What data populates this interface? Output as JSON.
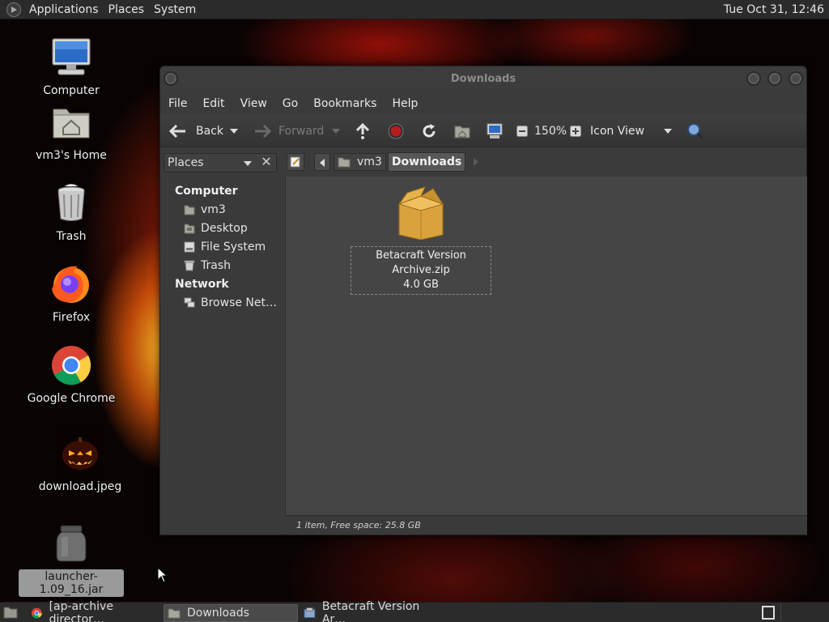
{
  "top_panel": {
    "menus": [
      "Applications",
      "Places",
      "System"
    ],
    "clock": "Tue Oct 31, 12:46"
  },
  "desktop": {
    "icons": [
      {
        "label": "Computer",
        "icon": "computer-icon"
      },
      {
        "label": "vm3's Home",
        "icon": "home-folder-icon"
      },
      {
        "label": "Trash",
        "icon": "trash-icon"
      },
      {
        "label": "Firefox",
        "icon": "firefox-icon"
      },
      {
        "label": "Google Chrome",
        "icon": "chrome-icon"
      },
      {
        "label": "download.jpeg",
        "icon": "image-thumbnail-icon"
      },
      {
        "label": "launcher-1.09_16.jar",
        "icon": "jar-icon"
      }
    ]
  },
  "window": {
    "title": "Downloads",
    "menu": [
      "File",
      "Edit",
      "View",
      "Go",
      "Bookmarks",
      "Help"
    ],
    "toolbar": {
      "back": "Back",
      "forward": "Forward",
      "zoom": "150%",
      "view_mode": "Icon View"
    },
    "places_selector": "Places",
    "path": [
      "vm3",
      "Downloads"
    ],
    "sidebar": {
      "sections": [
        {
          "header": "Computer",
          "items": [
            {
              "label": "vm3",
              "icon": "home-icon"
            },
            {
              "label": "Desktop",
              "icon": "desktop-icon"
            },
            {
              "label": "File System",
              "icon": "drive-icon"
            },
            {
              "label": "Trash",
              "icon": "trash-icon"
            }
          ]
        },
        {
          "header": "Network",
          "items": [
            {
              "label": "Browse Net…",
              "icon": "network-icon"
            }
          ]
        }
      ]
    },
    "files": [
      {
        "name": "Betacraft Version Archive.zip",
        "size": "4.0 GB",
        "icon": "package-icon"
      }
    ],
    "status": "1 item, Free space: 25.8 GB"
  },
  "taskbar": {
    "tasks": [
      {
        "label": "[ap-archive director…",
        "icon": "chrome-icon",
        "active": false
      },
      {
        "label": "Downloads",
        "icon": "folder-icon",
        "active": true
      },
      {
        "label": "Betacraft Version Ar…",
        "icon": "archive-manager-icon",
        "active": false
      }
    ]
  }
}
